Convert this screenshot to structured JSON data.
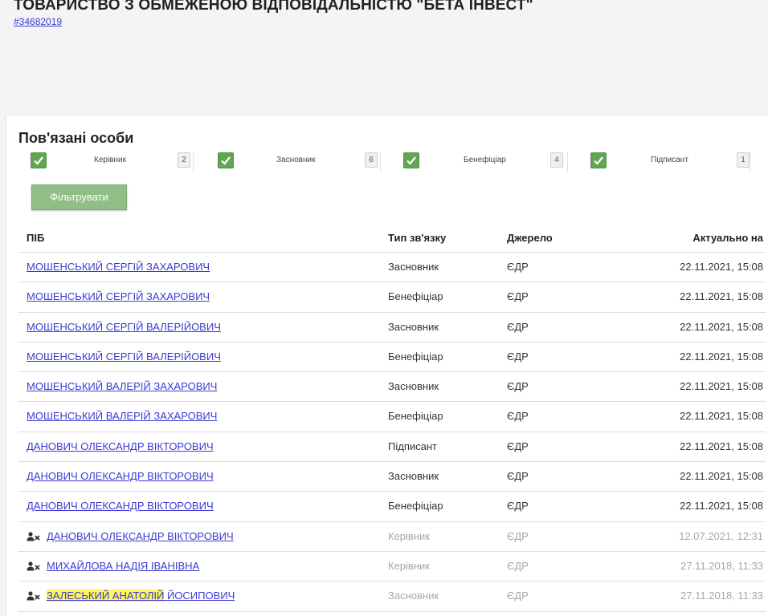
{
  "company": {
    "title": "ТОВАРИСТВО З ОБМЕЖЕНОЮ ВІДПОВІДАЛЬНІСТЮ \"БЕТА ІНВЕСТ\"",
    "code": "#34682019"
  },
  "section": {
    "title": "Пов'язані особи"
  },
  "filters": [
    {
      "label": "Керівник",
      "count": "2",
      "checked": true
    },
    {
      "label": "Засновник",
      "count": "6",
      "checked": true
    },
    {
      "label": "Бенефіціар",
      "count": "4",
      "checked": true
    },
    {
      "label": "Підписант",
      "count": "1",
      "checked": true
    }
  ],
  "filter_button_label": "Фільтрувати",
  "table": {
    "headers": {
      "name": "ПІБ",
      "type": "Тип зв'язку",
      "source": "Джерело",
      "date": "Актуально на"
    },
    "rows": [
      {
        "name": "МОШЕНСЬКИЙ СЕРГІЙ ЗАХАРОВИЧ",
        "type": "Засновник",
        "source": "ЄДР",
        "date": "22.11.2021, 15:08",
        "inactive": false
      },
      {
        "name": "МОШЕНСЬКИЙ СЕРГІЙ ЗАХАРОВИЧ",
        "type": "Бенефіціар",
        "source": "ЄДР",
        "date": "22.11.2021, 15:08",
        "inactive": false
      },
      {
        "name": "МОШЕНСЬКИЙ СЕРГІЙ ВАЛЕРІЙОВИЧ",
        "type": "Засновник",
        "source": "ЄДР",
        "date": "22.11.2021, 15:08",
        "inactive": false
      },
      {
        "name": "МОШЕНСЬКИЙ СЕРГІЙ ВАЛЕРІЙОВИЧ",
        "type": "Бенефіціар",
        "source": "ЄДР",
        "date": "22.11.2021, 15:08",
        "inactive": false
      },
      {
        "name": "МОШЕНСЬКИЙ ВАЛЕРІЙ ЗАХАРОВИЧ",
        "type": "Засновник",
        "source": "ЄДР",
        "date": "22.11.2021, 15:08",
        "inactive": false
      },
      {
        "name": "МОШЕНСЬКИЙ ВАЛЕРІЙ ЗАХАРОВИЧ",
        "type": "Бенефіціар",
        "source": "ЄДР",
        "date": "22.11.2021, 15:08",
        "inactive": false
      },
      {
        "name": "ДАНОВИЧ ОЛЕКСАНДР ВІКТОРОВИЧ",
        "type": "Підписант",
        "source": "ЄДР",
        "date": "22.11.2021, 15:08",
        "inactive": false
      },
      {
        "name": "ДАНОВИЧ ОЛЕКСАНДР ВІКТОРОВИЧ",
        "type": "Засновник",
        "source": "ЄДР",
        "date": "22.11.2021, 15:08",
        "inactive": false
      },
      {
        "name": "ДАНОВИЧ ОЛЕКСАНДР ВІКТОРОВИЧ",
        "type": "Бенефіціар",
        "source": "ЄДР",
        "date": "22.11.2021, 15:08",
        "inactive": false
      },
      {
        "name": "ДАНОВИЧ ОЛЕКСАНДР ВІКТОРОВИЧ",
        "type": "Керівник",
        "source": "ЄДР",
        "date": "12.07.2021, 12:31",
        "inactive": true
      },
      {
        "name": "МИХАЙЛОВА НАДІЯ ІВАНІВНА",
        "type": "Керівник",
        "source": "ЄДР",
        "date": "27.11.2018, 11:33",
        "inactive": true
      },
      {
        "name_highlighted": "ЗАЛЕСЬКИЙ АНАТОЛІЙ",
        "name_rest": " ЙОСИПОВИЧ",
        "type": "Засновник",
        "source": "ЄДР",
        "date": "27.11.2018, 11:33",
        "inactive": true
      }
    ]
  },
  "colors": {
    "link": "#3a3ad6",
    "checkbox": "#62a654",
    "button": "#8fbe86",
    "highlight": "#fdf35c",
    "dim_text": "#a6a6a6"
  },
  "icons": {
    "inactive_person": "user-x-icon",
    "checkbox_mark": "checkmark-icon"
  }
}
